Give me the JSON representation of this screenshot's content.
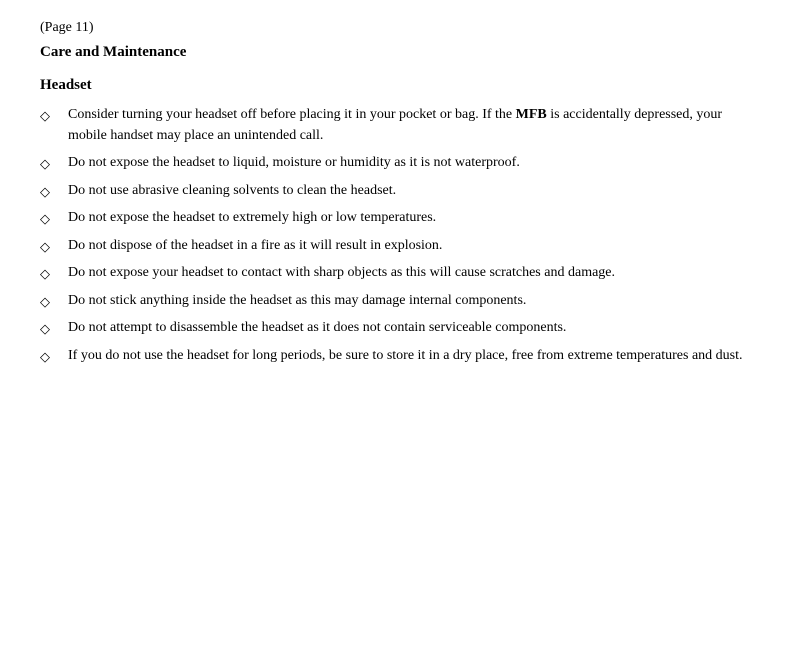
{
  "page": {
    "page_number": "(Page 11)",
    "section_title": "Care and Maintenance",
    "subsection": {
      "title": "Headset",
      "bullet_icon": "◇",
      "bullets": [
        {
          "id": 1,
          "text_parts": [
            {
              "text": "Consider turning your headset off before placing it in your pocket or bag. If the ",
              "bold": false
            },
            {
              "text": "MFB",
              "bold": true
            },
            {
              "text": " is accidentally depressed, your mobile handset may place an unintended call.",
              "bold": false
            }
          ]
        },
        {
          "id": 2,
          "text_parts": [
            {
              "text": "Do not expose the headset to liquid, moisture or humidity as it is not waterproof.",
              "bold": false
            }
          ]
        },
        {
          "id": 3,
          "text_parts": [
            {
              "text": "Do not use abrasive cleaning solvents to clean the headset.",
              "bold": false
            }
          ]
        },
        {
          "id": 4,
          "text_parts": [
            {
              "text": "Do not expose the headset to extremely high or low temperatures.",
              "bold": false
            }
          ]
        },
        {
          "id": 5,
          "text_parts": [
            {
              "text": "Do not dispose of the headset in a fire as it will result in explosion.",
              "bold": false
            }
          ]
        },
        {
          "id": 6,
          "text_parts": [
            {
              "text": "Do not expose your headset to contact with sharp objects as this will cause scratches and damage.",
              "bold": false
            }
          ]
        },
        {
          "id": 7,
          "text_parts": [
            {
              "text": "Do not stick anything inside the headset as this may damage internal components.",
              "bold": false
            }
          ]
        },
        {
          "id": 8,
          "text_parts": [
            {
              "text": "Do not attempt to disassemble the headset as it does not contain serviceable components.",
              "bold": false
            }
          ]
        },
        {
          "id": 9,
          "text_parts": [
            {
              "text": "If you do not use the headset for long periods, be sure to store it in a dry place, free from extreme temperatures and dust.",
              "bold": false
            }
          ]
        }
      ]
    }
  }
}
